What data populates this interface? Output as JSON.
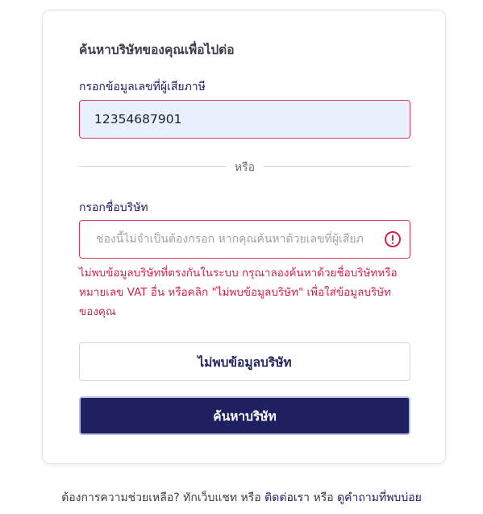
{
  "form": {
    "title": "ค้นหาบริษัทของคุณเพื่อไปต่อ",
    "tax_id": {
      "label": "กรอกข้อมูลเลขที่ผู้เสียภาษี",
      "value": "12354687901"
    },
    "divider_text": "หรือ",
    "company_name": {
      "label": "กรอกชื่อบริษัท",
      "placeholder": "ช่องนี้ไม่จำเป็นต้องกรอก หากคุณค้นหาด้วยเลขที่ผู้เสียภ",
      "error_message": "ไม่พบข้อมูลบริษัทที่ตรงกันในระบบ กรุณาลองค้นหาด้วยชื่อบริษัทหรือหมายเลข VAT อื่น หรือคลิก \"ไม่พบข้อมูลบริษัท\" เพื่อใส่ข้อมูลบริษัทของคุณ",
      "error_icon": "alert-circle-icon"
    },
    "not_found_button": "ไม่พบข้อมูลบริษัท",
    "search_button": "ค้นหาบริษัท"
  },
  "footer": {
    "prefix": "ต้องการความช่วยเหลือ? ทักเว็บแชท หรือ ",
    "contact_link": "ติดต่อเรา",
    "middle": " หรือ ",
    "faq_link": "ดูคำถามที่พบบ่อย"
  },
  "colors": {
    "primary": "#1f2060",
    "error": "#d2234d",
    "input_error_border": "#d83a52",
    "autofill_bg": "#e8f0fe"
  }
}
